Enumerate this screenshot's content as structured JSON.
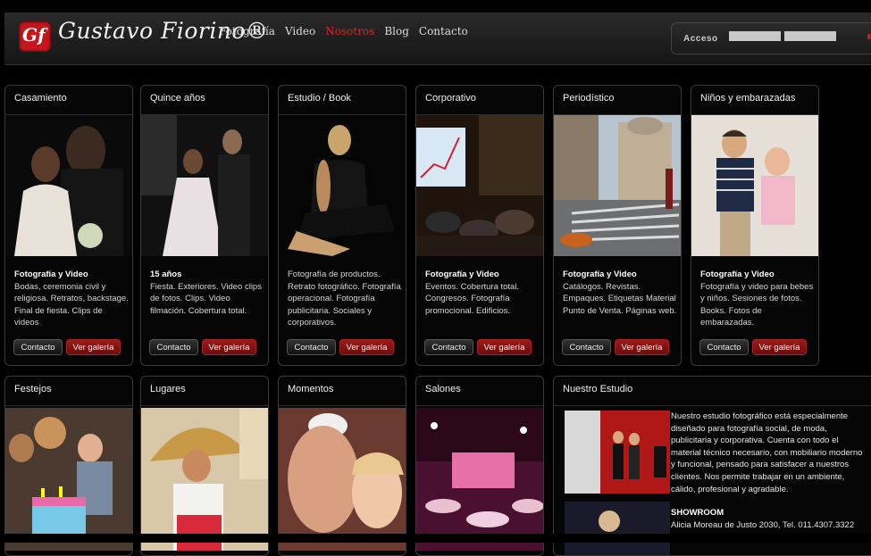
{
  "brand": {
    "logo_mark": "Gf",
    "name": "Gustavo Fiorino®"
  },
  "nav": [
    "Fotografía",
    "Video",
    "Nosotros",
    "Blog",
    "Contacto"
  ],
  "nav_active": "Nosotros",
  "login": {
    "label": "Acceso",
    "user_value": "",
    "pass_value": ""
  },
  "colors": {
    "accent": "#c4161c",
    "background": "#000000",
    "card_border": "#3a3a3a"
  },
  "services": [
    {
      "title": "Casamiento",
      "bold": "Fotografía y Video",
      "text": "Bodas, ceremonia civil y religiosa. Retratos, backstage. Final de fiesta. Clips de videos",
      "contact": "Contacto",
      "gallery": "Ver galería"
    },
    {
      "title": "Quince años",
      "bold": "15 años",
      "text": "Fiesta. Exteriores. Video clips de fotos. Clips. Video filmación. Cobertura total.",
      "contact": "Contacto",
      "gallery": "Ver galería"
    },
    {
      "title": "Estudio / Book",
      "bold": "",
      "text": "Fotografía de productos. Retrato fotográfico. Fotografía operacional. Fotografía publicitaria. Sociales y corporativos.",
      "contact": "Contacto",
      "gallery": "Ver galería"
    },
    {
      "title": "Corporativo",
      "bold": "Fotografía y Video",
      "text": "Eventos. Cobertura total. Congresos. Fotografía promocional. Edificios.",
      "contact": "Contacto",
      "gallery": "Ver galería"
    },
    {
      "title": "Periodístico",
      "bold": "Fotografía y Video",
      "text": "Catálogos. Revistas. Empaques. Etiquetas Material Punto de Venta. Páginas web.",
      "contact": "Contacto",
      "gallery": "Ver galería"
    },
    {
      "title": "Niños y embarazadas",
      "bold": "Fotografía y Video",
      "text": "Fotografía y video para bebes y niños. Sesiones de fotos. Books. Fotos de embarazadas.",
      "contact": "Contacto",
      "gallery": "Ver galería"
    }
  ],
  "galleries": [
    {
      "title": "Festejos"
    },
    {
      "title": "Lugares"
    },
    {
      "title": "Momentos"
    },
    {
      "title": "Salones"
    }
  ],
  "estudio": {
    "title": "Nuestro Estudio",
    "text": "Nuestro estudio fotográfico está especialmente diseñado para fotografía social, de moda, publicitaria y corporativa. Cuenta con todo el material técnico necesario, con mobiliario moderno y funcional, pensado para satisfacer a nuestros clientes. Nos permite trabajar en un ambiente, cálido, profesional y agradable.",
    "showroom_label": "SHOWROOM",
    "address": "Alicia Moreau de Justo 2030, Tel. 011.4307.3322"
  }
}
